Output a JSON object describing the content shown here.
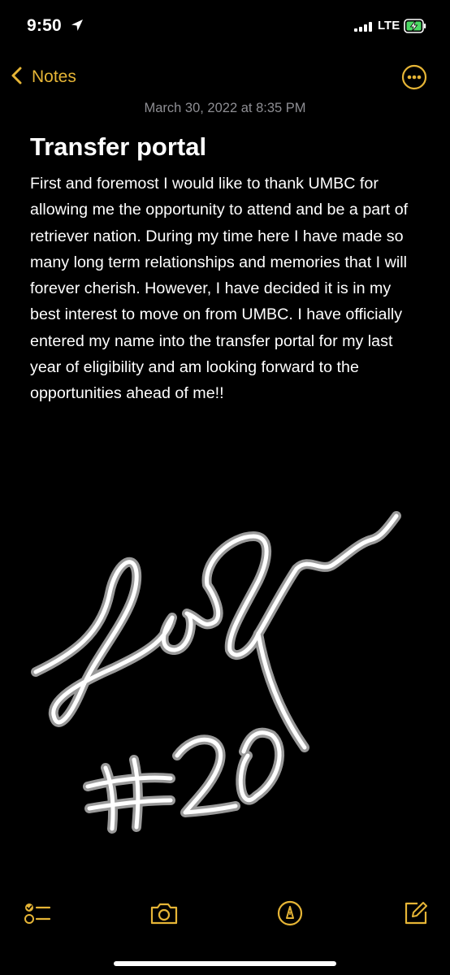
{
  "status_bar": {
    "time": "9:50",
    "network": "LTE",
    "icons": [
      "location-arrow-icon",
      "signal-bars-icon",
      "battery-charging-icon"
    ]
  },
  "nav": {
    "back_label": "Notes",
    "back_icon": "chevron-left-icon",
    "more_icon": "ellipsis-circle-icon"
  },
  "note": {
    "date": "March 30, 2022 at 8:35 PM",
    "title": "Transfer portal",
    "body": "First and foremost I would like to thank UMBC for allowing me the opportunity to attend and be a part of retriever nation. During my time here I have made so many long term relationships and memories that I will forever cherish. However, I have decided it is in my best interest to move on from UMBC. I have officially entered my name into the transfer portal for my last year of eligibility and am looking forward to the opportunities ahead of me!!",
    "signature_text": "#20"
  },
  "toolbar": {
    "icons": [
      "checklist-icon",
      "camera-icon",
      "markup-icon",
      "compose-icon"
    ]
  },
  "colors": {
    "background": "#000000",
    "accent": "#e6b536",
    "secondary_text": "#8e8e93",
    "text": "#ffffff"
  }
}
